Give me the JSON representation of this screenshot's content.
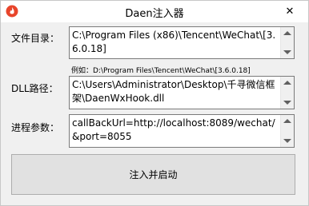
{
  "window": {
    "title": "Daen注入器",
    "close_glyph": "✕"
  },
  "fields": {
    "file_dir": {
      "label": "文件目录：",
      "value": "C:\\Program Files (x86)\\Tencent\\WeChat\\[3.6.0.18]",
      "hint": "例如：D:\\Program Files\\Tencent\\WeChat\\[3.6.0.18]"
    },
    "dll_path": {
      "label": "DLL路径：",
      "value": "C:\\Users\\Administrator\\Desktop\\千寻微信框架\\DaenWxHook.dll"
    },
    "process_args": {
      "label": "进程参数：",
      "value": "callBackUrl=http://localhost:8089/wechat/&port=8055"
    }
  },
  "actions": {
    "start_label": "注入并启动"
  },
  "icons": {
    "app": "flame-icon",
    "close": "close-icon"
  },
  "colors": {
    "app_icon": "#e8452b",
    "window_bg": "#f0f0f0",
    "button_bg": "#e1e1e1"
  }
}
